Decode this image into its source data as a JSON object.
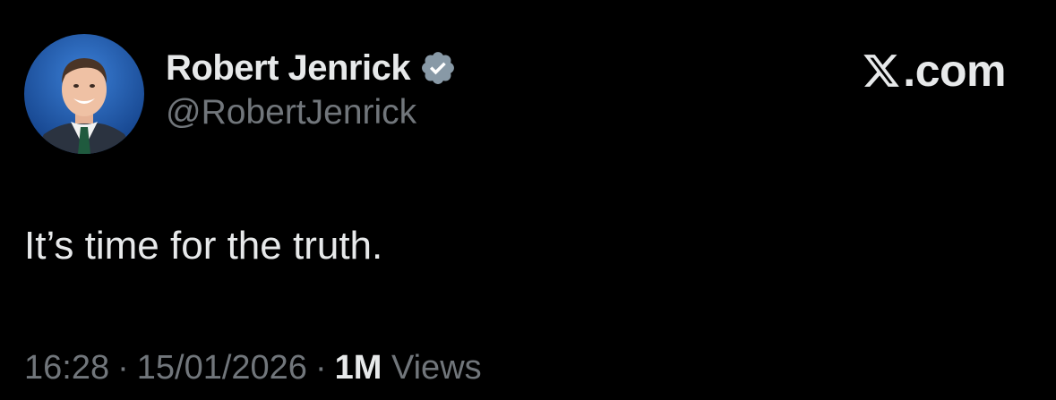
{
  "author": {
    "display_name": "Robert Jenrick",
    "handle": "@RobertJenrick",
    "verified": true,
    "verified_badge_color": "#8899a6"
  },
  "brand": {
    "domain": ".com",
    "icon": "x-logo-icon"
  },
  "tweet": {
    "text": "It’s time for the truth."
  },
  "meta": {
    "time": "16:28",
    "separator": "·",
    "date": "15/01/2026",
    "views_count": "1M",
    "views_label": "Views"
  },
  "colors": {
    "background": "#000000",
    "primary_text": "#e7e9ea",
    "secondary_text": "#71767b"
  }
}
